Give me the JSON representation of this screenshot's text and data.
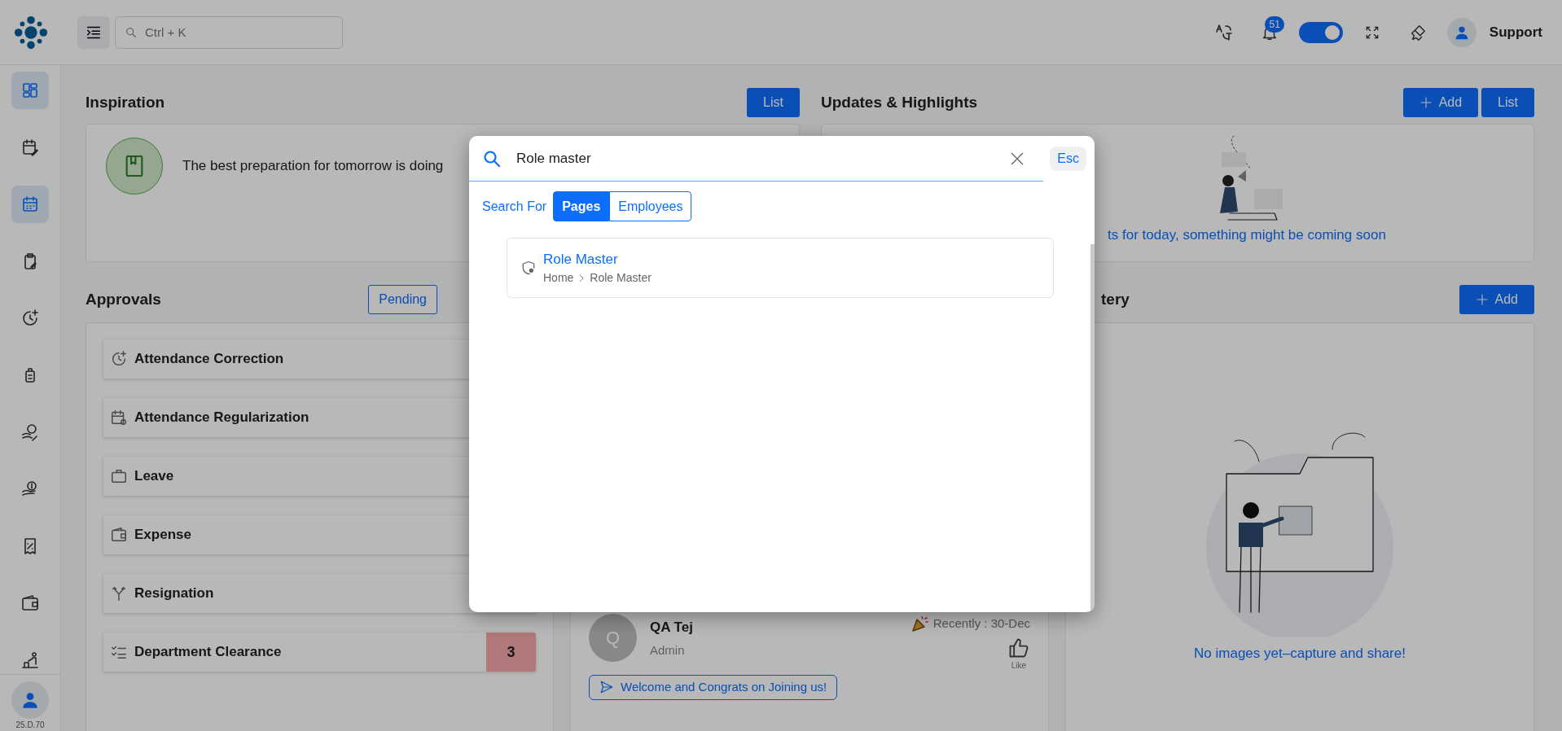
{
  "app": {
    "version": "25.D.70"
  },
  "sidebar": {
    "items": [
      {
        "selected": true
      },
      {
        "selected": false
      },
      {
        "selected": true
      },
      {
        "selected": false
      },
      {
        "selected": false
      },
      {
        "selected": false
      },
      {
        "selected": false
      },
      {
        "selected": false
      },
      {
        "selected": false
      },
      {
        "selected": false
      },
      {
        "selected": false
      }
    ]
  },
  "topbar": {
    "search": {
      "placeholder": "Ctrl + K"
    },
    "notifications": {
      "count": "51"
    },
    "theme_toggle": {
      "on": true
    },
    "user": {
      "name": "Support"
    }
  },
  "inspiration": {
    "title": "Inspiration",
    "buttons": [
      {
        "label": "List",
        "kind": "plain"
      }
    ],
    "quote": "The best preparation for tomorrow is doing"
  },
  "updates": {
    "title": "Updates & Highlights",
    "buttons": [
      {
        "label": "Add",
        "kind": "add"
      },
      {
        "label": "List",
        "kind": "plain"
      }
    ],
    "empty_message": "ts for today, something might be coming soon"
  },
  "approvals": {
    "title": "Approvals",
    "filters": [
      {
        "label": "Pending",
        "selected": true
      }
    ],
    "items": [
      {
        "label": "Attendance Correction"
      },
      {
        "label": "Attendance Regularization"
      },
      {
        "label": "Leave"
      },
      {
        "label": "Expense"
      },
      {
        "label": "Resignation"
      },
      {
        "label": "Department Clearance",
        "count": "3"
      }
    ]
  },
  "wishes": {
    "people": [
      {
        "initial": "Q",
        "name": "QA Tej",
        "role": "Admin",
        "date": "Recently : 30-Dec",
        "like": "Like",
        "message": "Welcome and Congrats on Joining us!"
      }
    ]
  },
  "gallery": {
    "title": "tery",
    "buttons": [
      {
        "label": "Add",
        "kind": "add"
      }
    ],
    "empty_message": "No images yet–capture and share!"
  },
  "search_dialog": {
    "query": "Role master",
    "esc": "Esc",
    "search_for": "Search For",
    "scopes": [
      {
        "label": "Pages",
        "selected": true
      },
      {
        "label": "Employees",
        "selected": false
      }
    ],
    "results": [
      {
        "title": "Role Master",
        "breadcrumb": [
          "Home",
          "Role Master"
        ]
      }
    ]
  }
}
